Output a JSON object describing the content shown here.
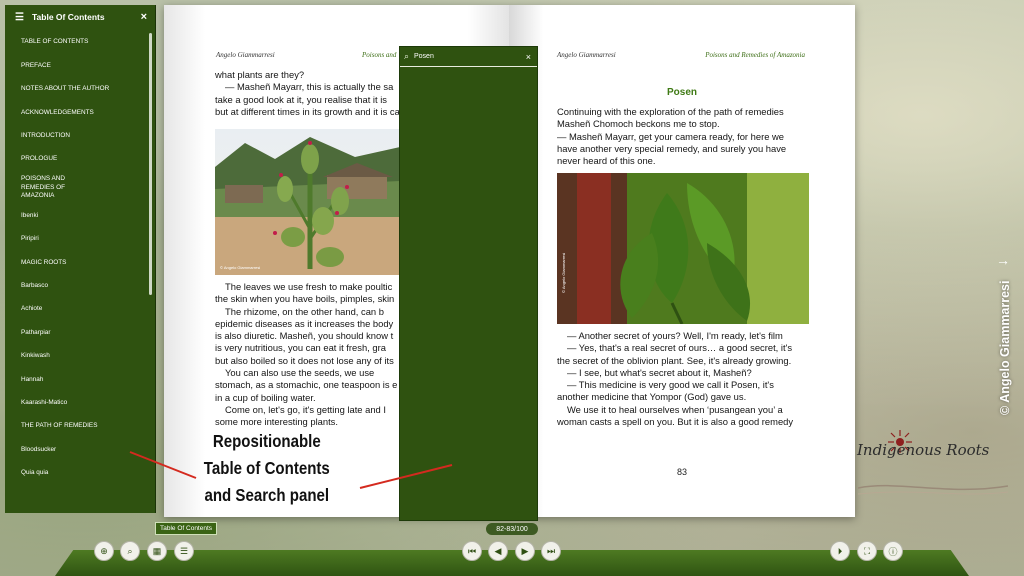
{
  "toc": {
    "title": "Table Of Contents",
    "close_glyph": "×",
    "items": [
      {
        "label": "TABLE OF CONTENTS"
      },
      {
        "label": "PREFACE"
      },
      {
        "label": "NOTES ABOUT THE AUTHOR"
      },
      {
        "label": "ACKNOWLEDGEMENTS"
      },
      {
        "label": "INTRODUCTION"
      },
      {
        "label": "PROLOGUE"
      },
      {
        "label": "POISONS AND REMEDIES OF AMAZONIA"
      },
      {
        "label": "Ibenki"
      },
      {
        "label": "Piripiri"
      },
      {
        "label": "MAGIC ROOTS"
      },
      {
        "label": "Barbasco"
      },
      {
        "label": "Achiote"
      },
      {
        "label": "Patharpiar"
      },
      {
        "label": "Kinkiwash"
      },
      {
        "label": "Hannah"
      },
      {
        "label": "Kaarashi-Matico"
      },
      {
        "label": "THE PATH OF REMEDIES"
      },
      {
        "label": "Bloodsucker"
      },
      {
        "label": "Quia quia"
      }
    ]
  },
  "book": {
    "left": {
      "header_author": "Angelo Giammarresi",
      "lines": [
        "what plants are they?",
        "— Masheñ Mayarr, this is actually the sa",
        "take a good look at it, you realise that it is",
        "but at different times in its growth and it is ca",
        "The leaves we use fresh to make poultic",
        "the skin when you have boils, pimples, skin",
        "The rhizome, on the other hand, can b",
        "epidemic diseases as it increases the body",
        "is also diuretic. Masheñ, you should know t",
        "is very nutritious, you can eat it fresh, gra",
        "but also boiled so it does not lose any of its",
        "You can also use the seeds, we use",
        "stomach, as a stomachic, one teaspoon is e",
        "in a cup of boiling water.",
        "Come on, let's go, it's getting late and I",
        "some more interesting plants."
      ],
      "photo_credit": "© Angelo Giammarresi"
    },
    "right": {
      "header_author": "Angelo Giammarresi",
      "header_title": "Poisons and Remedies of Amazonia",
      "chapter_title": "Posen",
      "para1": [
        "Continuing with the exploration of the path of remedies",
        "Masheñ Chomoch beckons me to stop.",
        "— Masheñ Mayarr, get your camera ready, for here we",
        "have another very special remedy, and surely you have",
        "never heard of this one."
      ],
      "para2": [
        "— Another secret of yours? Well, I'm ready, let's film",
        "— Yes, that's a real secret of ours… a good secret, it's",
        "the secret of the oblivion plant. See, it's already growing.",
        "— I see, but what's secret about it,  Masheñ?",
        "— This medicine is very good we call it Posen, it's",
        "another medicine that Yompor (God) gave us.",
        "We use it to heal ourselves when ‘pusangean you’ a",
        "woman casts a spell on you. But it is also a good remedy"
      ],
      "photo_credit": "© Angelo Giammarresi",
      "page_number": "83"
    },
    "left_header_title": "Poisons and"
  },
  "search": {
    "value": "Posen",
    "close_glyph": "×"
  },
  "annotation": {
    "line1": "Repositionable",
    "line2": "Table of Contents",
    "line3": "and Search panel"
  },
  "branding": {
    "logo_text": "Indigenous Roots",
    "author_vertical": "© Angelo Giammarresi",
    "next_glyph": "→"
  },
  "toolbar": {
    "tooltip": "Table Of Contents",
    "page_indicator": "82-83/100",
    "buttons": [
      {
        "name": "zoom-in-button",
        "icon": "zoom-in-icon",
        "glyph": "⊕"
      },
      {
        "name": "search-button",
        "icon": "search-icon",
        "glyph": "⌕"
      },
      {
        "name": "thumbnails-button",
        "icon": "grid-icon",
        "glyph": "▦"
      },
      {
        "name": "toc-button",
        "icon": "list-icon",
        "glyph": "☰"
      },
      {
        "name": "first-page-button",
        "icon": "first-page-icon",
        "glyph": "⏮"
      },
      {
        "name": "prev-page-button",
        "icon": "prev-page-icon",
        "glyph": "◀"
      },
      {
        "name": "next-page-button",
        "icon": "next-page-icon",
        "glyph": "▶"
      },
      {
        "name": "last-page-button",
        "icon": "last-page-icon",
        "glyph": "⏭"
      },
      {
        "name": "autoplay-button",
        "icon": "play-icon",
        "glyph": "⏵"
      },
      {
        "name": "fullscreen-button",
        "icon": "fullscreen-icon",
        "glyph": "⛶"
      },
      {
        "name": "info-button",
        "icon": "info-icon",
        "glyph": "ⓘ"
      }
    ]
  },
  "colors": {
    "panel_green": "#2f5210",
    "chapter_green": "#3f7a15",
    "annotation_arrow": "#d42a1f"
  }
}
